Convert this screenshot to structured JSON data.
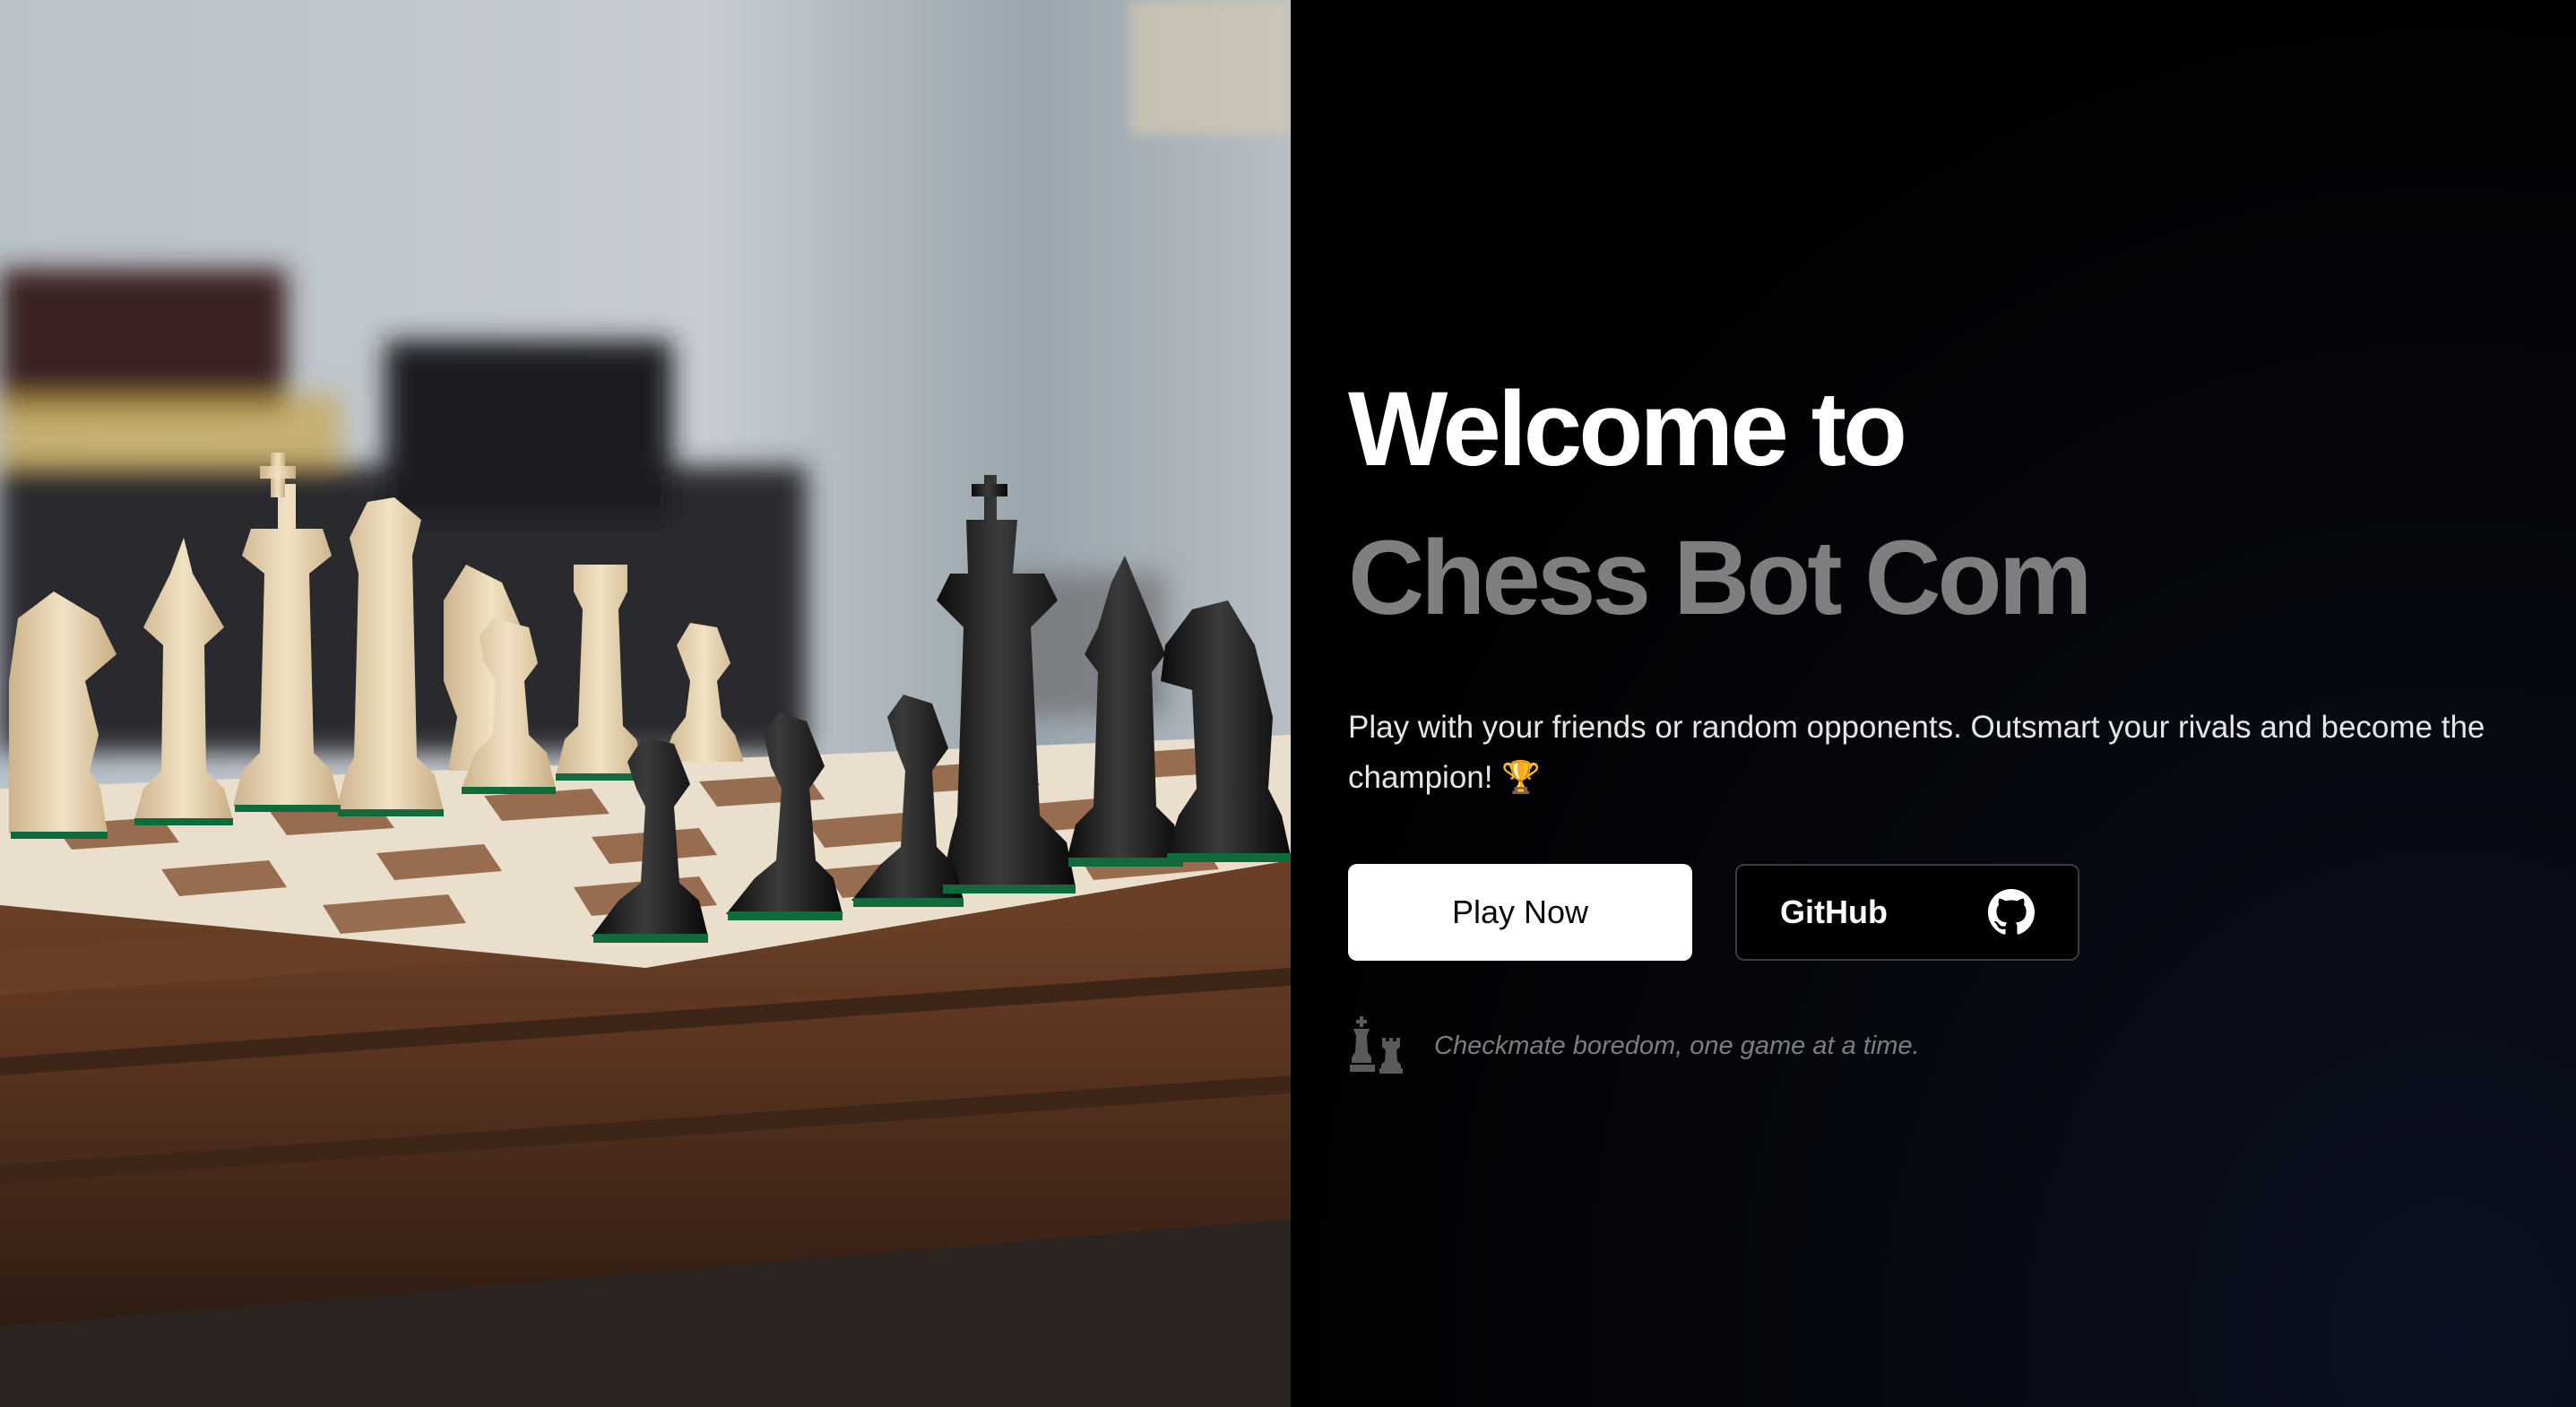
{
  "hero": {
    "image": "chess-board-photo"
  },
  "headline": {
    "line1": "Welcome to",
    "line2": "Chess Bot Com"
  },
  "description": "Play with your friends or random opponents. Outsmart your rivals and become the champion! 🏆",
  "buttons": {
    "play_label": "Play Now",
    "github_label": "GitHub",
    "github_icon": "github-icon"
  },
  "tagline": {
    "icon": "chess-pieces-icon",
    "text": "Checkmate boredom, one game at a time."
  },
  "colors": {
    "background": "#000000",
    "headline_primary": "#ffffff",
    "headline_secondary": "#7f7f7f",
    "button_primary_bg": "#ffffff",
    "button_outline": "#3b3b3b"
  }
}
